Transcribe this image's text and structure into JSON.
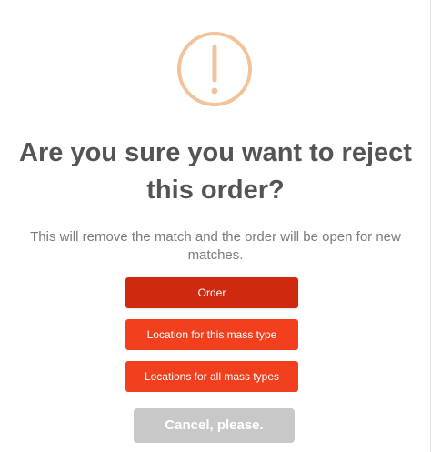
{
  "dialog": {
    "icon": "warning-exclamation-icon",
    "accent_color": "#f2c29a",
    "title": "Are you sure you want to reject this order?",
    "message": "This will remove the match and the order will be open for new matches.",
    "buttons": {
      "order": "Order",
      "location_this_type": "Location for this mass type",
      "location_all_types": "Locations for all mass types",
      "cancel": "Cancel, please."
    },
    "colors": {
      "primary_button": "#cf2a10",
      "secondary_button": "#f2401f",
      "cancel_button": "#c8c8c8",
      "title_text": "#545454",
      "message_text": "#7b7b7b"
    }
  }
}
